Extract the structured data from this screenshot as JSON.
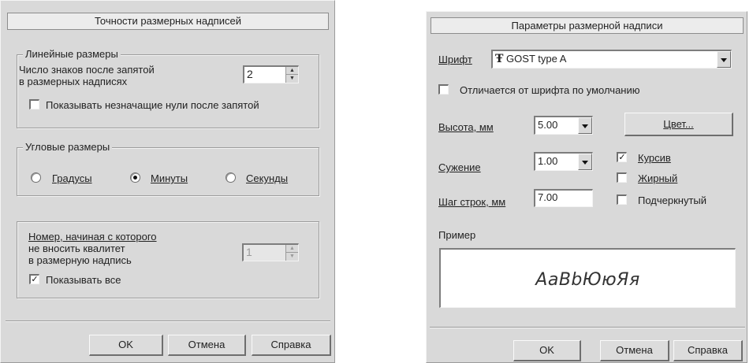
{
  "left_dialog": {
    "title": "Точности размерных надписей",
    "linear_group": {
      "legend": "Линейные размеры",
      "decimals_label_line1": "Число знаков после запятой",
      "decimals_label_line2": "в размерных надписях",
      "decimals_value": "2",
      "show_zeros_label": "Показывать незначащие нули после запятой",
      "show_zeros_checked": false
    },
    "angular_group": {
      "legend": "Угловые размеры",
      "options": [
        {
          "label": "Градусы",
          "selected": false
        },
        {
          "label": "Минуты",
          "selected": true
        },
        {
          "label": "Секунды",
          "selected": false
        }
      ]
    },
    "tolerance_group": {
      "label_line1": "Номер, начиная с которого",
      "label_line2": "не вносить квалитет",
      "label_line3": "в размерную надпись",
      "number_value": "1",
      "show_all_label": "Показывать все",
      "show_all_checked": true
    },
    "buttons": {
      "ok": "OK",
      "cancel": "Отмена",
      "help": "Справка"
    }
  },
  "right_dialog": {
    "title": "Параметры размерной надписи",
    "font_label": "Шрифт",
    "font_icon": "truetype-font-icon",
    "font_value": "GOST type A",
    "differs_label": "Отличается от шрифта по умолчанию",
    "differs_checked": false,
    "height_label": "Высота, мм",
    "height_value": "5.00",
    "color_button": "Цвет...",
    "narrowing_label": "Сужение",
    "narrowing_value": "1.00",
    "line_step_label": "Шаг строк, мм",
    "line_step_value": "7.00",
    "styles": [
      {
        "label": "Курсив",
        "checked": true
      },
      {
        "label": "Жирный",
        "checked": false
      },
      {
        "label": "Подчеркнутый",
        "checked": false
      }
    ],
    "sample_label": "Пример",
    "sample_text": "АаВbЮюЯя",
    "buttons": {
      "ok": "OK",
      "cancel": "Отмена",
      "help": "Справка"
    }
  }
}
